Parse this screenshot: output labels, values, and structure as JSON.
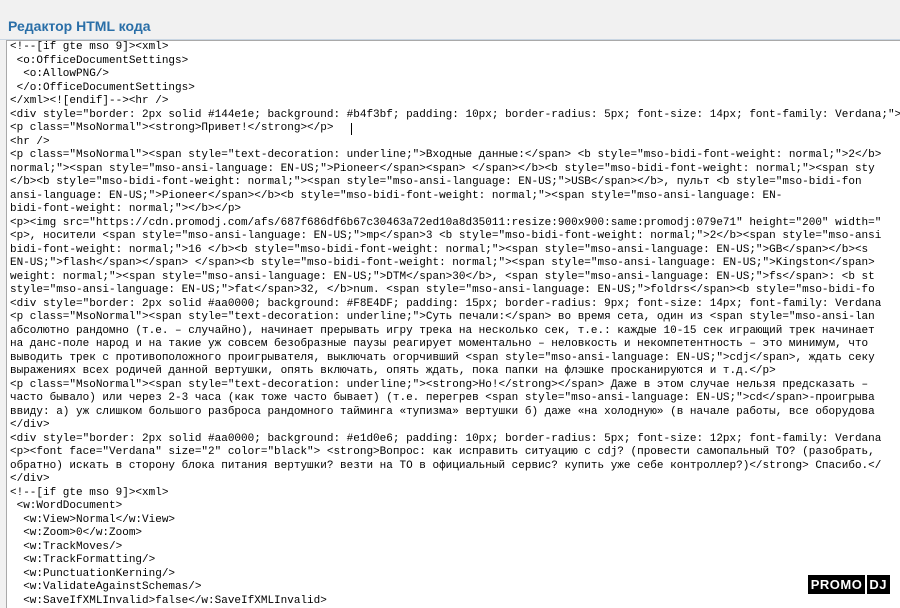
{
  "editor": {
    "title": "Редактор HTML кода",
    "lines": [
      "<!--[if gte mso 9]><xml>",
      " <o:OfficeDocumentSettings>",
      "  <o:AllowPNG/>",
      " </o:OfficeDocumentSettings>",
      "</xml><![endif]--><hr />",
      "<div style=\"border: 2px solid #144e1e; background: #b4f3bf; padding: 10px; border-radius: 5px; font-size: 14px; font-family: Verdana;\">",
      "<p class=\"MsoNormal\"><strong>Привет!</strong></p>",
      "<hr />",
      "<p class=\"MsoNormal\"><span style=\"text-decoration: underline;\">Входные данные:</span> <b style=\"mso-bidi-font-weight: normal;\">2</b>",
      "normal;\"><span style=\"mso-ansi-language: EN-US;\">Pioneer</span><span> </span></b><b style=\"mso-bidi-font-weight: normal;\"><span sty",
      "</b><b style=\"mso-bidi-font-weight: normal;\"><span style=\"mso-ansi-language: EN-US;\">USB</span></b>, пульт <b style=\"mso-bidi-fon",
      "ansi-language: EN-US;\">Pioneer</span></b><b style=\"mso-bidi-font-weight: normal;\"><span style=\"mso-ansi-language: EN-",
      "bidi-font-weight: normal;\"></b></p>",
      "<p><img src=\"https://cdn.promodj.com/afs/687f686df6b67c30463a72ed10a8d35011:resize:900x900:same:promodj:079e71\" height=\"200\" width=\"",
      "<p>, носители <span style=\"mso-ansi-language: EN-US;\">mp</span>3 <b style=\"mso-bidi-font-weight: normal;\">2</b><span style=\"mso-ansi",
      "bidi-font-weight: normal;\">16 </b><b style=\"mso-bidi-font-weight: normal;\"><span style=\"mso-ansi-language: EN-US;\">GB</span></b><s",
      "EN-US;\">flash</span></span> </span><b style=\"mso-bidi-font-weight: normal;\"><span style=\"mso-ansi-language: EN-US;\">Kingston</span>",
      "weight: normal;\"><span style=\"mso-ansi-language: EN-US;\">DTM</span>30</b>, <span style=\"mso-ansi-language: EN-US;\">fs</span>: <b st",
      "style=\"mso-ansi-language: EN-US;\">fat</span>32, </b>num. <span style=\"mso-ansi-language: EN-US;\">foldrs</span><b style=\"mso-bidi-fo",
      "<div style=\"border: 2px solid #aa0000; background: #F8E4DF; padding: 15px; border-radius: 9px; font-size: 14px; font-family: Verdana",
      "<p class=\"MsoNormal\"><span style=\"text-decoration: underline;\">Суть печали:</span> во время сета, один из <span style=\"mso-ansi-lan",
      "абсолютно рандомно (т.е. – случайно), начинает прерывать игру трека на несколько сек, т.е.: каждые 10-15 сек играющий трек начинает",
      "на данс-поле народ и на такие уж совсем безобразные паузы реагирует моментально – неловкость и некомпетентность – это минимум, что ",
      "выводить трек с противоположного проигрывателя, выключать огорчивший <span style=\"mso-ansi-language: EN-US;\">cdj</span>, ждать секу",
      "выражениях всех родичей данной вертушки, опять включать, опять ждать, пока папки на флэшке просканируются и т.д.</p>",
      "<p class=\"MsoNormal\"><span style=\"text-decoration: underline;\"><strong>Но!</strong></span> Даже в этом случае нельзя предсказать –",
      "часто бывало) или через 2-3 часа (как тоже часто бывает) (т.е. перегрев <span style=\"mso-ansi-language: EN-US;\">cd</span>-проигрыва",
      "ввиду: а) уж слишком большого разброса рандомного тайминга «тупизма» вертушки б) даже «на холодную» (в начале работы, все оборудова",
      "</div>",
      "<div style=\"border: 2px solid #aa0000; background: #e1d0e6; padding: 10px; border-radius: 5px; font-size: 12px; font-family: Verdana",
      "<p><font face=\"Verdana\" size=\"2\" color=\"black\"> <strong>Вопрос: как исправить ситуацию с cdj? (провести самопальный ТО? (разобрать,",
      "обратно) искать в сторону блока питания вертушки? везти на ТО в официальный сервис? купить уже себе контроллер?)</strong> Спасибо.</",
      "</div>",
      "<!--[if gte mso 9]><xml>",
      " <w:WordDocument>",
      "  <w:View>Normal</w:View>",
      "  <w:Zoom>0</w:Zoom>",
      "  <w:TrackMoves/>",
      "  <w:TrackFormatting/>",
      "  <w:PunctuationKerning/>",
      "  <w:ValidateAgainstSchemas/>",
      "  <w:SaveIfXMLInvalid>false</w:SaveIfXMLInvalid>"
    ]
  },
  "logo": {
    "left": "PROMO",
    "right": "DJ"
  }
}
